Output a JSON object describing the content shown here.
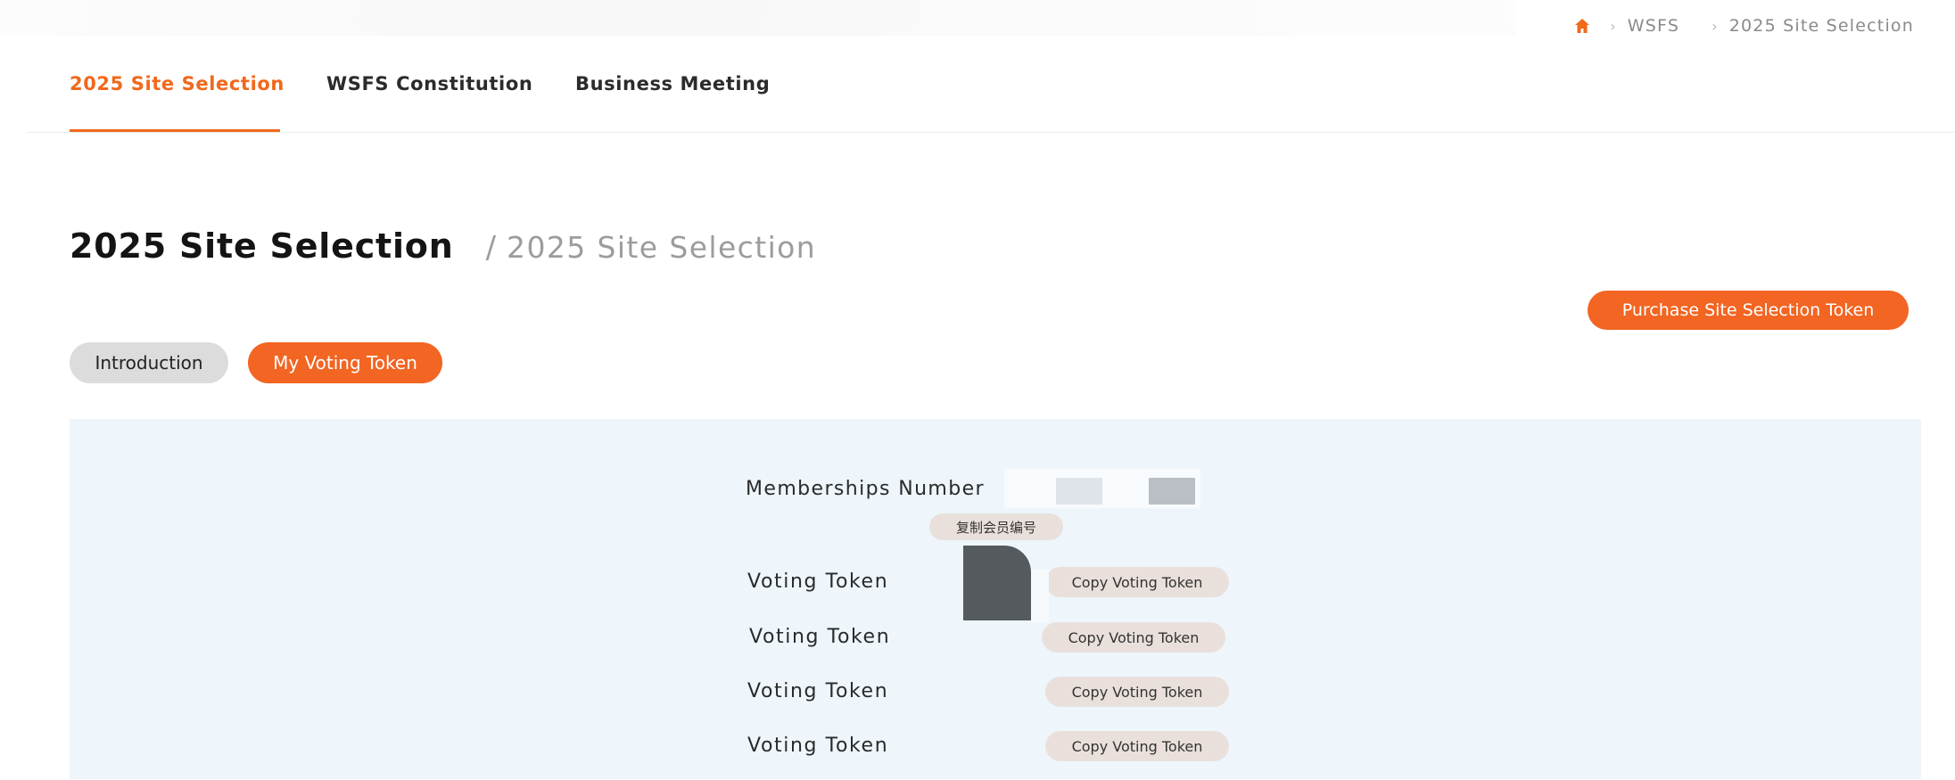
{
  "breadcrumb": {
    "home_icon": "home-icon",
    "items": [
      "WSFS",
      "2025 Site Selection"
    ],
    "separator": "›",
    "home_color": "#f0691c"
  },
  "topnav": {
    "tabs": [
      {
        "label": "2025 Site Selection",
        "active": true
      },
      {
        "label": "WSFS Constitution",
        "active": false
      },
      {
        "label": "Business Meeting",
        "active": false
      }
    ]
  },
  "heading": {
    "title": "2025 Site Selection",
    "separator": "/",
    "subtitle": "2025 Site Selection"
  },
  "purchase_button": {
    "label": "Purchase Site Selection Token"
  },
  "subtabs": [
    {
      "label": "Introduction",
      "active": false
    },
    {
      "label": "My Voting Token",
      "active": true
    }
  ],
  "panel": {
    "membership_label": "Memberships Number",
    "copy_membership_label": "复制会员编号",
    "tokens": [
      {
        "label": "Voting Token",
        "copy_label": "Copy Voting Token"
      },
      {
        "label": "Voting Token",
        "copy_label": "Copy Voting Token"
      },
      {
        "label": "Voting Token",
        "copy_label": "Copy Voting Token"
      },
      {
        "label": "Voting Token",
        "copy_label": "Copy Voting Token"
      }
    ]
  },
  "colors": {
    "accent": "#f26522",
    "panel_bg": "#eef6fc",
    "pill_inactive": "#dcdcdc"
  }
}
